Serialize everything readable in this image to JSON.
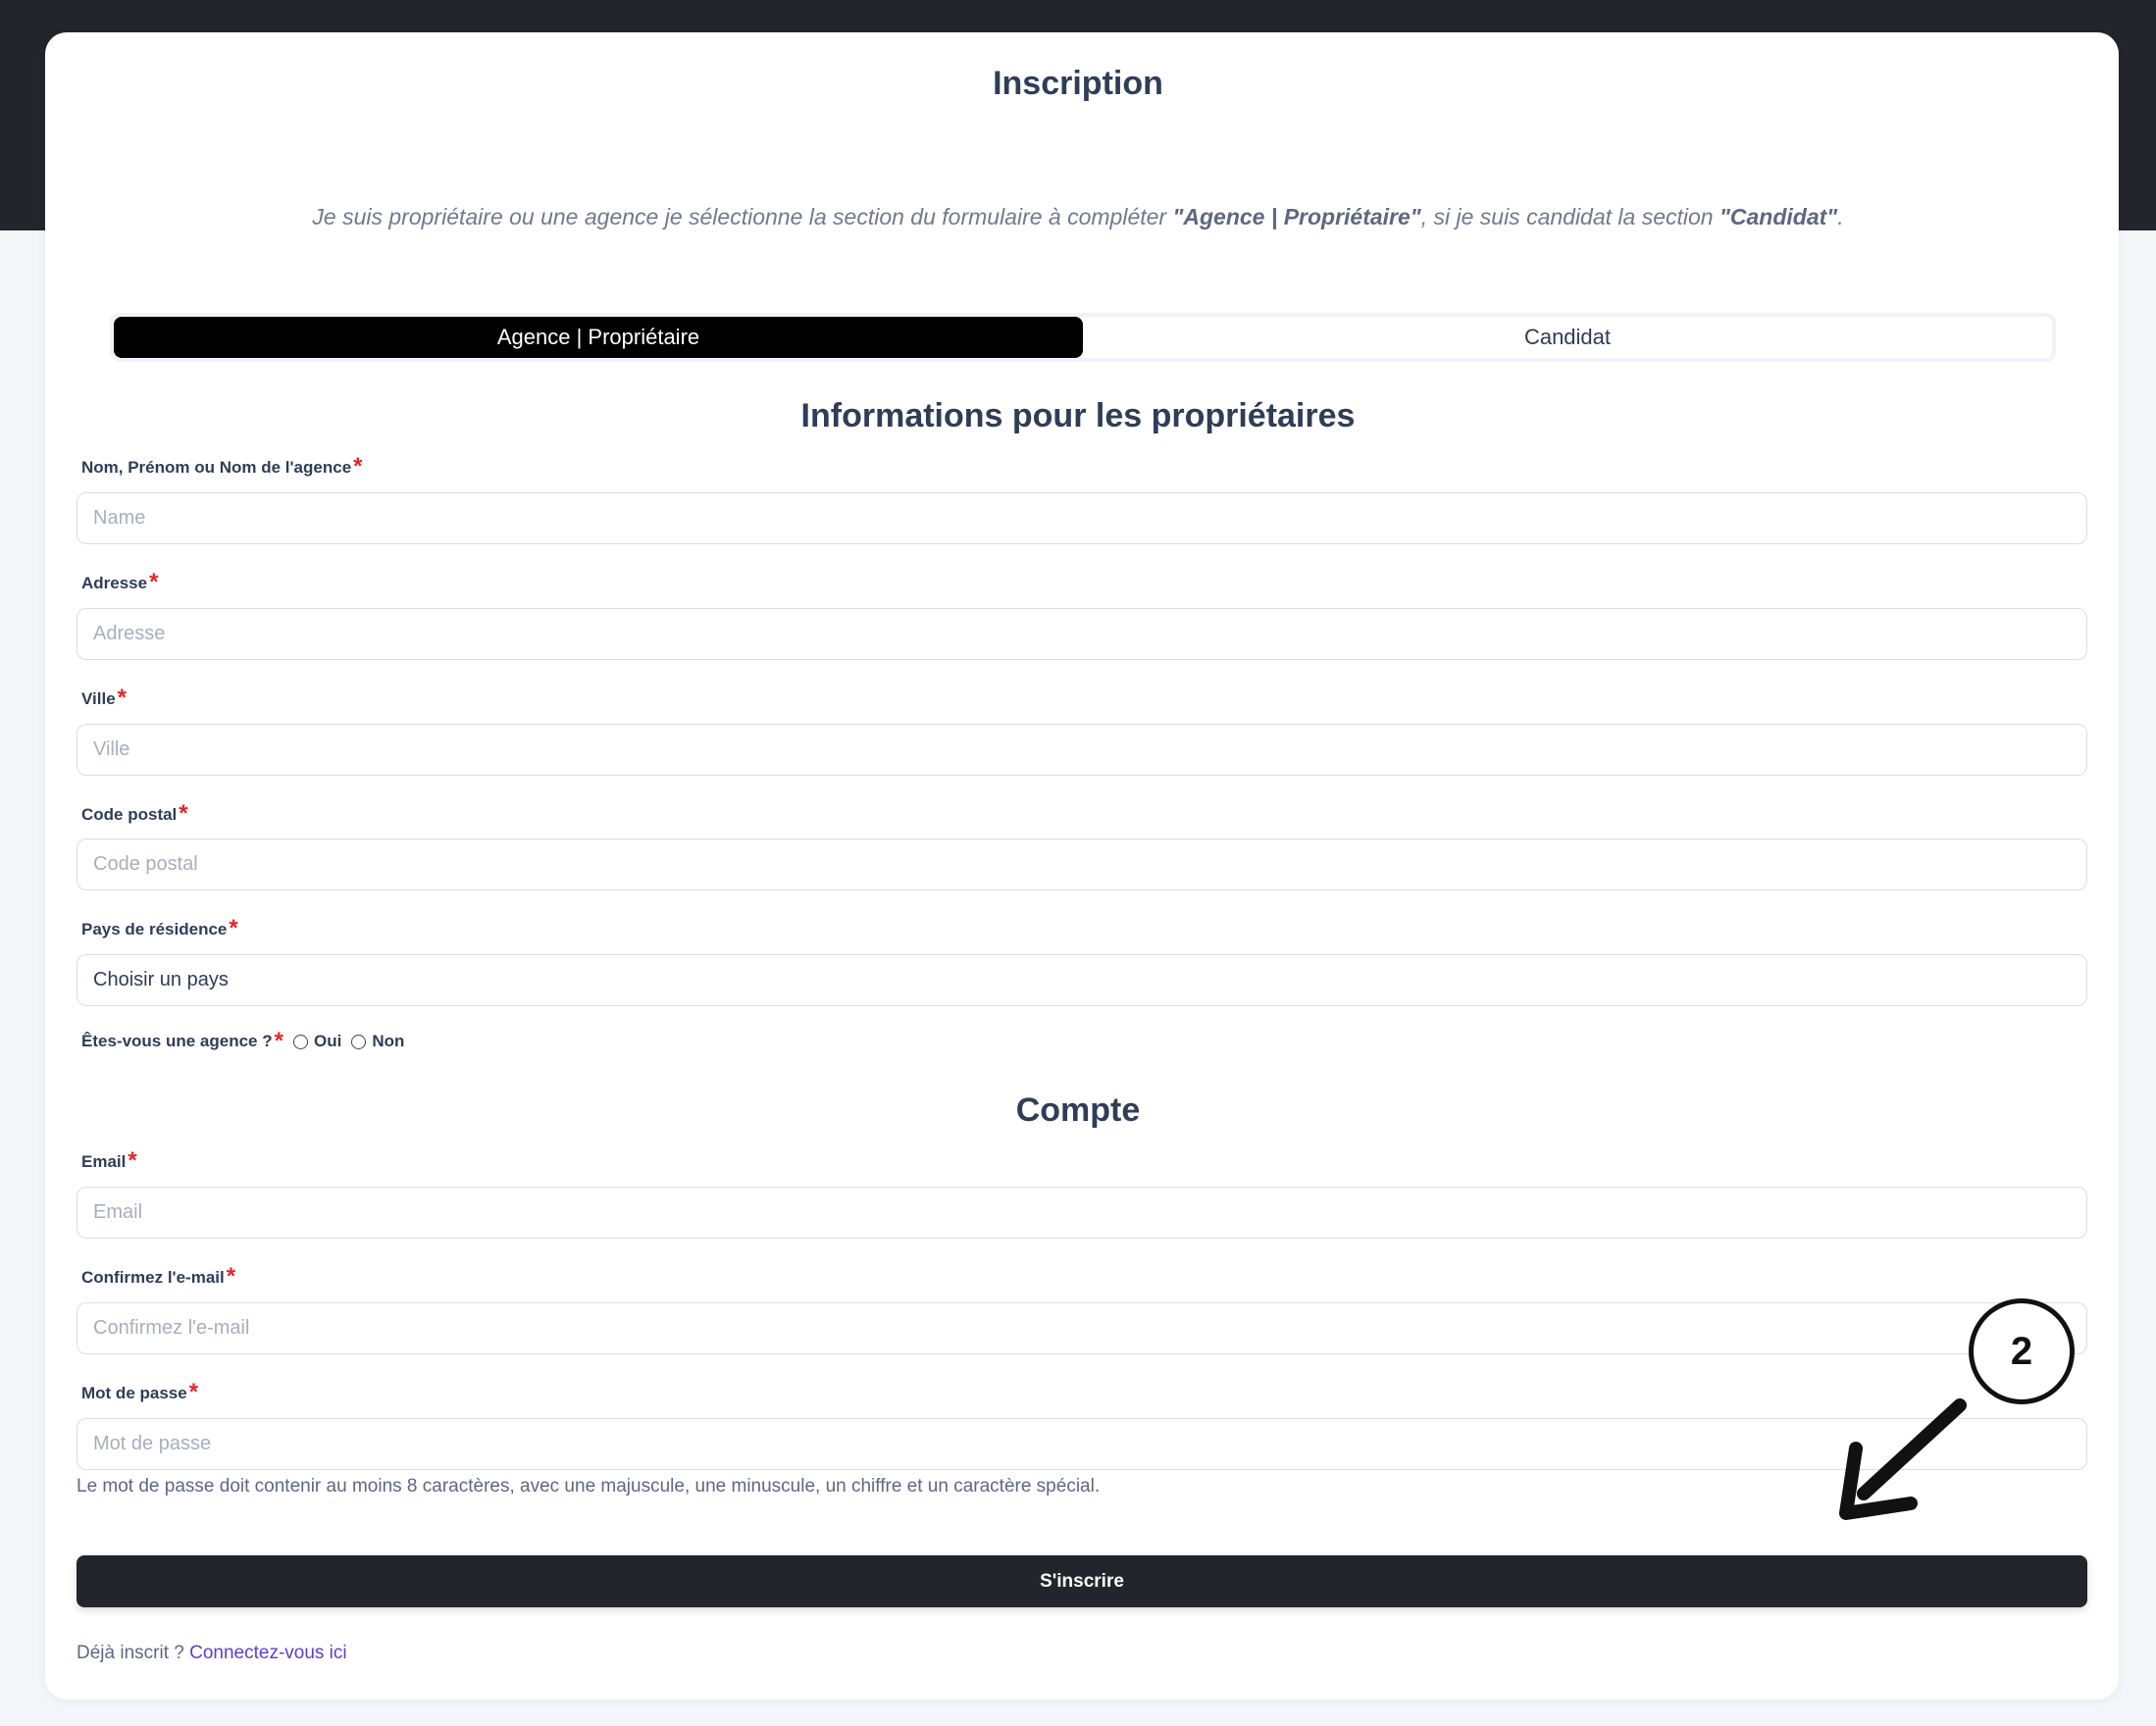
{
  "page": {
    "title": "Inscription",
    "intro_prefix": "Je suis propriétaire ou une agence je sélectionne la section du formulaire à compléter ",
    "intro_bold1": "\"Agence | Propriétaire\"",
    "intro_middle": ", si je suis candidat la section ",
    "intro_bold2": "\"Candidat\"",
    "intro_suffix": "."
  },
  "tabs": [
    {
      "label": "Agence | Propriétaire",
      "active": true
    },
    {
      "label": "Candidat",
      "active": false
    }
  ],
  "owner_section": {
    "title": "Informations pour les propriétaires",
    "fields": [
      {
        "label": "Nom, Prénom ou Nom de l'agence",
        "placeholder": "Name",
        "value": ""
      },
      {
        "label": "Adresse",
        "placeholder": "Adresse",
        "value": ""
      },
      {
        "label": "Ville",
        "placeholder": "Ville",
        "value": ""
      },
      {
        "label": "Code postal",
        "placeholder": "Code postal",
        "value": ""
      }
    ],
    "country": {
      "label": "Pays de résidence",
      "selected": "Choisir un pays"
    },
    "agency_question": {
      "label": "Êtes-vous une agence ?",
      "options": [
        "Oui",
        "Non"
      ]
    }
  },
  "account_section": {
    "title": "Compte",
    "fields": [
      {
        "label": "Email",
        "placeholder": "Email",
        "value": ""
      },
      {
        "label": "Confirmez l'e-mail",
        "placeholder": "Confirmez l'e-mail",
        "value": ""
      },
      {
        "label": "Mot de passe",
        "placeholder": "Mot de passe",
        "value": ""
      }
    ],
    "password_hint": "Le mot de passe doit contenir au moins 8 caractères, avec une majuscule, une minuscule, un chiffre et un caractère spécial."
  },
  "required_mark": "*",
  "submit_label": "S'inscrire",
  "login": {
    "prompt": "Déjà inscrit ? ",
    "link": "Connectez-vous ici"
  },
  "annotation": {
    "step_number": "2"
  }
}
